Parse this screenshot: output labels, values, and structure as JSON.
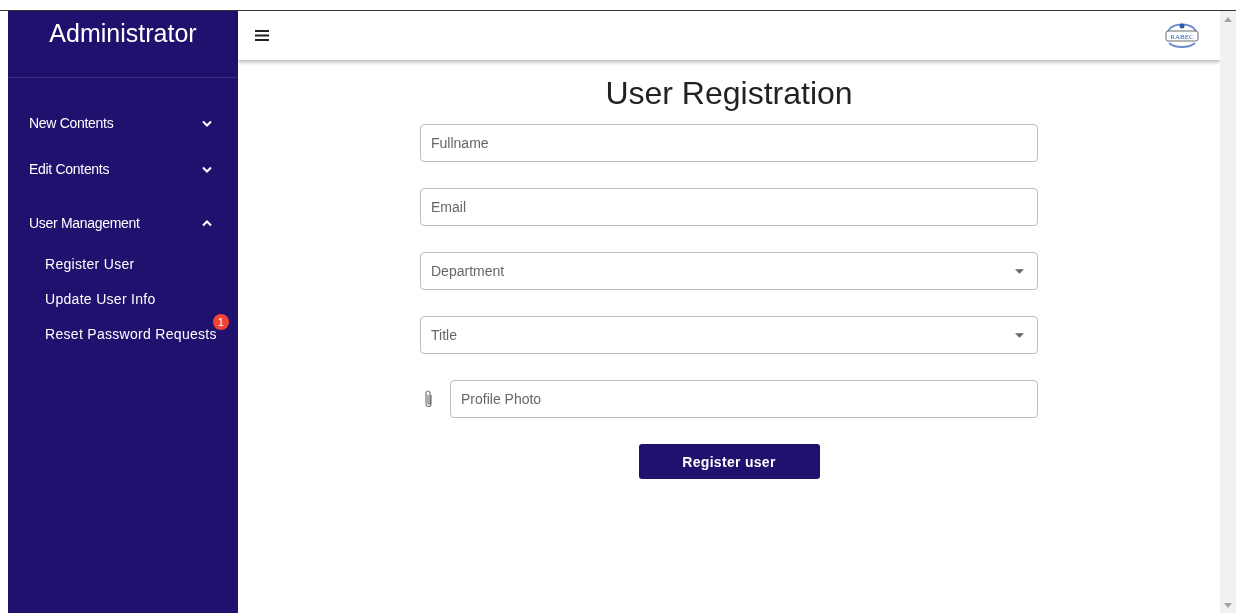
{
  "sidebar": {
    "title": "Administrator",
    "items": [
      {
        "label": "New Contents",
        "expanded": false
      },
      {
        "label": "Edit Contents",
        "expanded": false
      },
      {
        "label": "User Management",
        "expanded": true,
        "children": [
          {
            "label": "Register User"
          },
          {
            "label": "Update User Info"
          },
          {
            "label": "Reset Password Requests",
            "badge": "1"
          }
        ]
      }
    ]
  },
  "header": {
    "logo_text": "RABEC"
  },
  "form": {
    "title": "User Registration",
    "fields": [
      {
        "kind": "text",
        "placeholder": "Fullname"
      },
      {
        "kind": "text",
        "placeholder": "Email"
      },
      {
        "kind": "select",
        "placeholder": "Department"
      },
      {
        "kind": "select",
        "placeholder": "Title"
      },
      {
        "kind": "file",
        "placeholder": "Profile Photo"
      }
    ],
    "submit": "Register user"
  }
}
